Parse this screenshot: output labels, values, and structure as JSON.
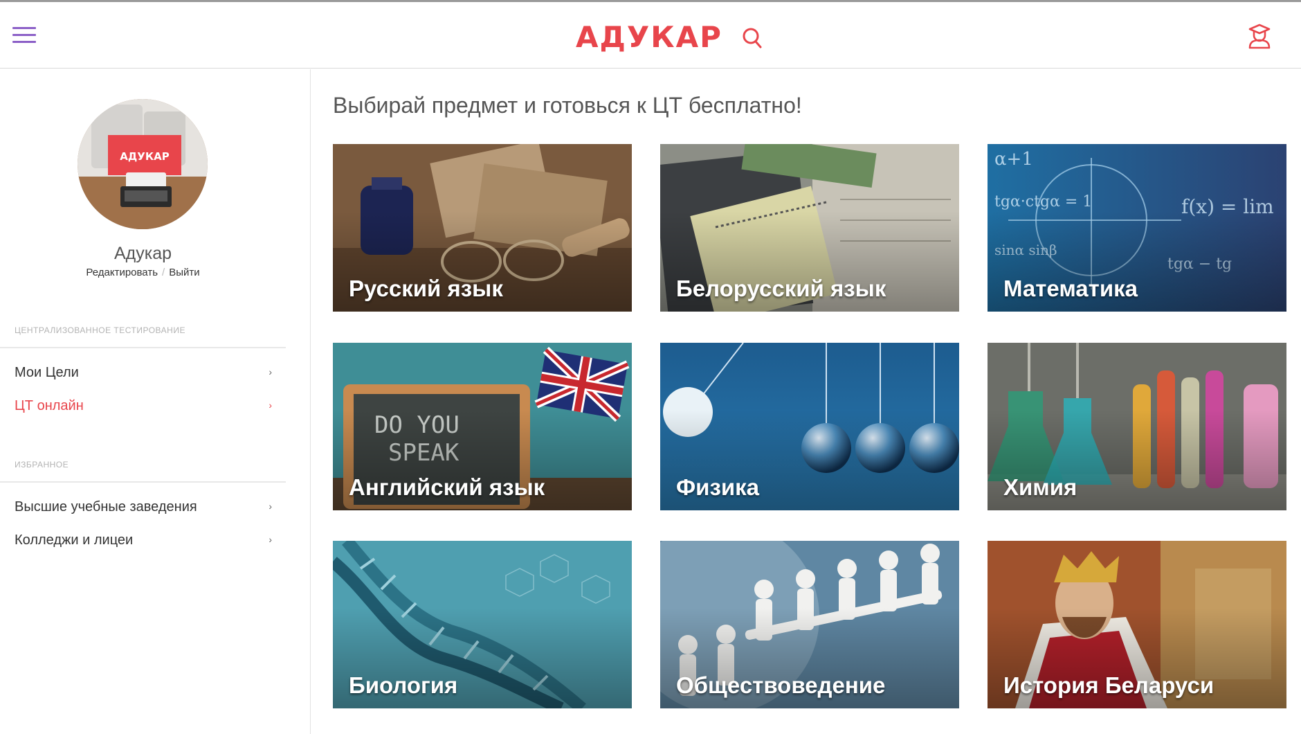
{
  "header": {
    "logo": "АДУКАР"
  },
  "sidebar": {
    "user_name": "Адукар",
    "edit_link": "Редактировать",
    "separator": "/",
    "logout_link": "Выйти",
    "avatar_sign": "АДУКАР",
    "section1_title": "Централизованное тестирование",
    "section1_items": [
      {
        "label": "Мои Цели",
        "active": false
      },
      {
        "label": "ЦТ онлайн",
        "active": true
      }
    ],
    "section2_title": "Избранное",
    "section2_items": [
      {
        "label": "Высшие учебные заведения",
        "active": false
      },
      {
        "label": "Колледжи и лицеи",
        "active": false
      }
    ],
    "chevron": "›"
  },
  "main": {
    "title": "Выбирай предмет и готовься к ЦТ бесплатно!",
    "subjects": [
      {
        "label": "Русский язык"
      },
      {
        "label": "Белорусский язык"
      },
      {
        "label": "Математика"
      },
      {
        "label": "Английский язык"
      },
      {
        "label": "Физика"
      },
      {
        "label": "Химия"
      },
      {
        "label": "Биология"
      },
      {
        "label": "Обществоведение"
      },
      {
        "label": "История Беларуси"
      }
    ]
  },
  "colors": {
    "accent": "#e8454b",
    "menu_icon": "#8b5fc7"
  }
}
